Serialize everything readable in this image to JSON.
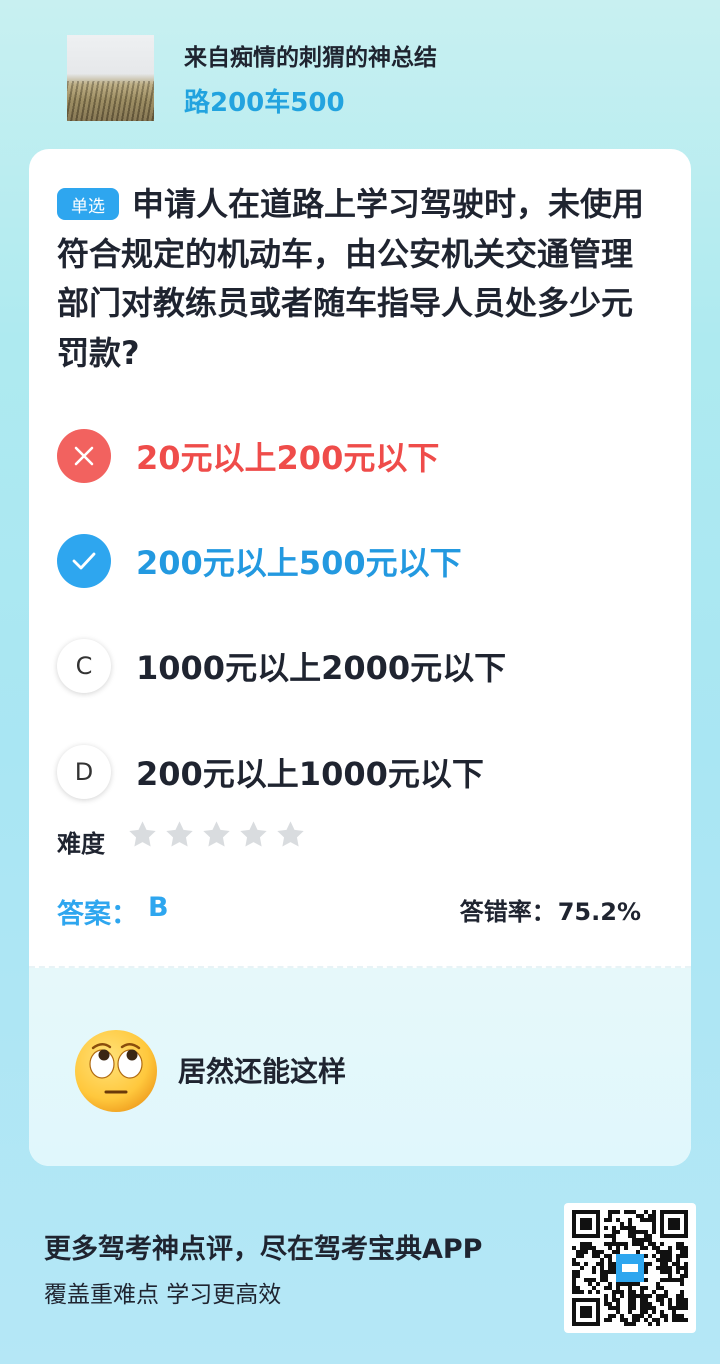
{
  "header": {
    "title": "来自痴情的刺猬的神总结",
    "subtitle": "路200车500"
  },
  "question": {
    "type_tag": "单选",
    "text": "申请人在道路上学习驾驶时，未使用符合规定的机动车，由公安机关交通管理部门对教练员或者随车指导人员处多少元罚款?"
  },
  "options": [
    {
      "marker": "",
      "text": "20元以上200元以下",
      "state": "wrong"
    },
    {
      "marker": "",
      "text": "200元以上500元以下",
      "state": "correct"
    },
    {
      "marker": "C",
      "text": "1000元以上2000元以下",
      "state": "normal"
    },
    {
      "marker": "D",
      "text": "200元以上1000元以下",
      "state": "normal"
    }
  ],
  "difficulty": {
    "label": "难度",
    "stars_filled": 0,
    "stars_total": 5
  },
  "answer": {
    "label": "答案：",
    "value": "B"
  },
  "error_rate": {
    "label": "答错率：",
    "value": "75.2%"
  },
  "comment": {
    "icon": "eye-roll-emoji",
    "text": "居然还能这样"
  },
  "promo": {
    "title": "更多驾考神点评，尽在驾考宝典APP",
    "subtitle": "覆盖重难点 学习更高效"
  },
  "colors": {
    "accent": "#2ea6ef",
    "wrong": "#f2625f",
    "text": "#1f2430"
  }
}
